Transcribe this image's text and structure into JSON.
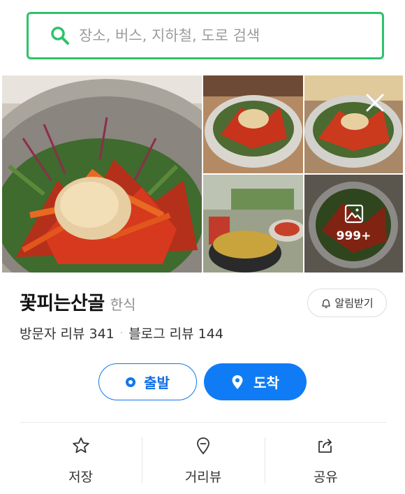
{
  "search": {
    "placeholder": "장소, 버스, 지하철, 도로 검색"
  },
  "photos": {
    "more_count": "999+"
  },
  "place": {
    "name": "꽃피는산골",
    "category": "한식",
    "notify_label": "알림받기",
    "visitor_reviews": "방문자 리뷰 341",
    "blog_reviews": "블로그 리뷰 144",
    "review_separator": "·"
  },
  "route": {
    "depart_label": "출발",
    "arrive_label": "도착"
  },
  "actions": {
    "save_label": "저장",
    "street_view_label": "거리뷰",
    "share_label": "공유"
  },
  "colors": {
    "search_border": "#2dc36a",
    "brand_blue": "#0f7cf5"
  },
  "icons": [
    "search-icon",
    "close-icon",
    "image-icon",
    "bell-icon",
    "ring-icon",
    "pin-icon",
    "star-icon",
    "location-pin-icon",
    "share-icon"
  ]
}
